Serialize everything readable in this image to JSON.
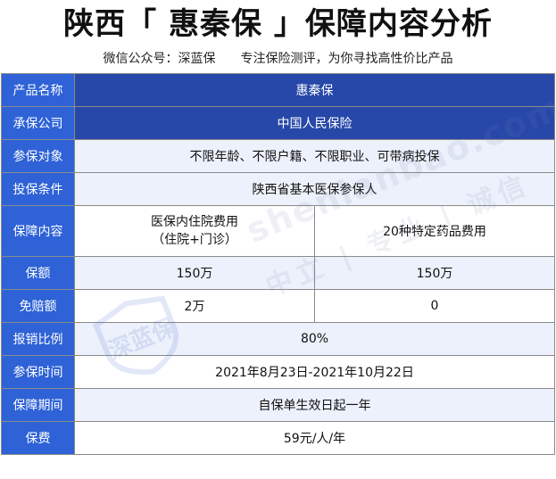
{
  "header": {
    "title": "陕西「 惠秦保 」保障内容分析",
    "wechat": "微信公众号：深蓝保",
    "slogan": "专注保险测评，为你寻找高性价比产品"
  },
  "table": {
    "product_name": {
      "label": "产品名称",
      "value": "惠秦保"
    },
    "insurer": {
      "label": "承保公司",
      "value": "中国人民保险"
    },
    "eligible": {
      "label": "参保对象",
      "value": "不限年龄、不限户籍、不限职业、可带病投保"
    },
    "conditions": {
      "label": "投保条件",
      "value": "陕西省基本医保参保人"
    },
    "coverage": {
      "label": "保障内容",
      "col1_line1": "医保内住院费用",
      "col1_line2": "（住院+门诊）",
      "col2": "20种特定药品费用"
    },
    "sum_insured": {
      "label": "保额",
      "col1": "150万",
      "col2": "150万"
    },
    "deductible": {
      "label": "免赔额",
      "col1": "2万",
      "col2": "0"
    },
    "reimbursement": {
      "label": "报销比例",
      "value": "80%"
    },
    "enroll_period": {
      "label": "参保时间",
      "value": "2021年8月23日-2021年10月22日"
    },
    "coverage_period": {
      "label": "保障期间",
      "value": "自保单生效日起一年"
    },
    "premium": {
      "label": "保费",
      "value": "59元/人/年"
    }
  },
  "watermark": {
    "site": "shenlanbao.com",
    "motto": "中立 | 专业 | 诚信",
    "logo_text": "深蓝保"
  }
}
